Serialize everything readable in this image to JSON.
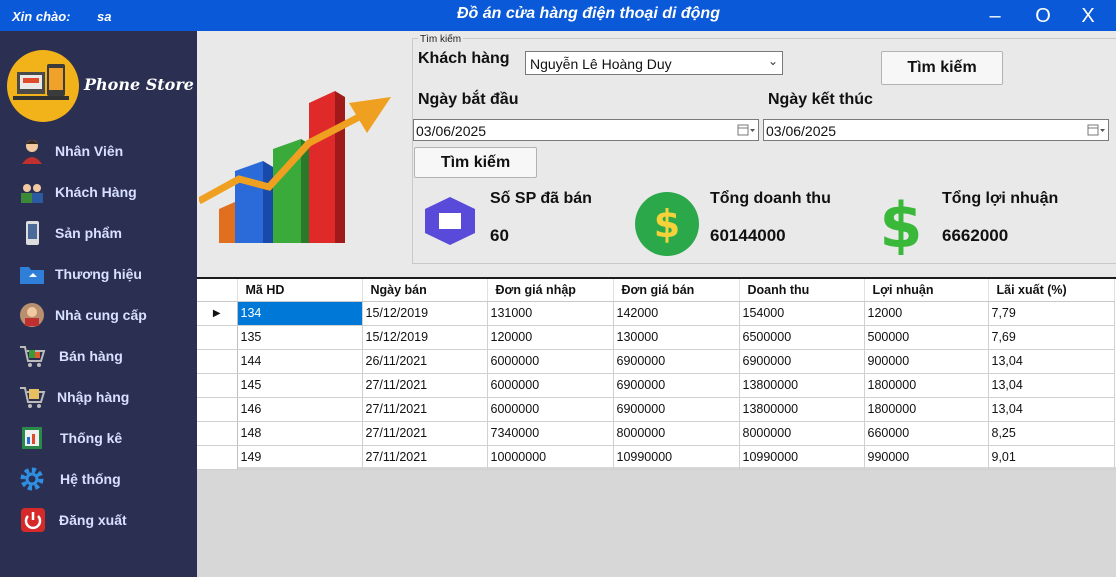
{
  "window": {
    "greeting": "Xin chào:",
    "user": "sa",
    "title": "Đồ án cửa hàng điện thoại di động",
    "minimize": "–",
    "maximize": "O",
    "close": "X"
  },
  "sidebar": {
    "brand": "Phone Store",
    "items": [
      {
        "label": "Nhân Viên",
        "icon": "employee-icon"
      },
      {
        "label": "Khách Hàng",
        "icon": "customers-icon"
      },
      {
        "label": "Sản phẩm",
        "icon": "phone-icon"
      },
      {
        "label": "Thương hiệu",
        "icon": "folder-icon"
      },
      {
        "label": "Nhà cung cấp",
        "icon": "supplier-icon"
      },
      {
        "label": "Bán hàng",
        "icon": "cart-icon"
      },
      {
        "label": "Nhập hàng",
        "icon": "import-cart-icon"
      },
      {
        "label": "Thống kê",
        "icon": "report-book-icon"
      },
      {
        "label": "Hệ thống",
        "icon": "gear-icon"
      },
      {
        "label": "Đăng xuất",
        "icon": "power-icon"
      }
    ]
  },
  "search": {
    "legend": "Tìm kiếm",
    "customer_label": "Khách hàng",
    "customer_value": "Nguyễn Lê Hoàng Duy",
    "search_button_1": "Tìm kiếm",
    "start_label": "Ngày bắt đầu",
    "end_label": "Ngày kết thúc",
    "start_date": "03/06/2025",
    "end_date": "03/06/2025",
    "search_button_2": "Tìm kiếm"
  },
  "stats": {
    "sold_label": "Số SP đã bán",
    "sold_value": "60",
    "revenue_label": "Tổng doanh thu",
    "revenue_value": "60144000",
    "profit_label": "Tổng lợi nhuận",
    "profit_value": "6662000"
  },
  "colors": {
    "titlebar": "#0a59d8",
    "sidebar": "#2b2f52",
    "selection": "#0078d7"
  },
  "table": {
    "columns": [
      "Mã HD",
      "Ngày bán",
      "Đơn giá nhập",
      "Đơn giá bán",
      "Doanh thu",
      "Lợi nhuận",
      "Lãi xuất (%)"
    ],
    "rows": [
      [
        "134",
        "15/12/2019",
        "131000",
        "142000",
        "154000",
        "12000",
        "7,79"
      ],
      [
        "135",
        "15/12/2019",
        "120000",
        "130000",
        "6500000",
        "500000",
        "7,69"
      ],
      [
        "144",
        "26/11/2021",
        "6000000",
        "6900000",
        "6900000",
        "900000",
        "13,04"
      ],
      [
        "145",
        "27/11/2021",
        "6000000",
        "6900000",
        "13800000",
        "1800000",
        "13,04"
      ],
      [
        "146",
        "27/11/2021",
        "6000000",
        "6900000",
        "13800000",
        "1800000",
        "13,04"
      ],
      [
        "148",
        "27/11/2021",
        "7340000",
        "8000000",
        "8000000",
        "660000",
        "8,25"
      ],
      [
        "149",
        "27/11/2021",
        "10000000",
        "10990000",
        "10990000",
        "990000",
        "9,01"
      ]
    ]
  }
}
